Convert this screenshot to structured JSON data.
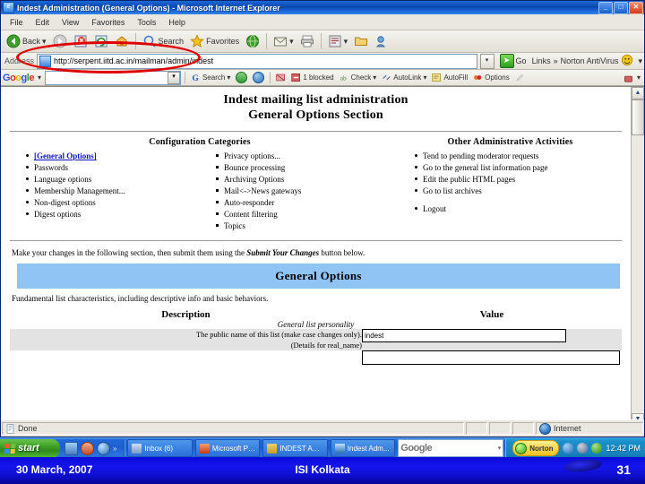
{
  "window": {
    "title": "Indest Administration (General Options) - Microsoft Internet Explorer",
    "icon": "ie-document-icon",
    "minimize_label": "_",
    "maximize_label": "□",
    "close_label": "✕"
  },
  "menubar": {
    "items": [
      {
        "label": "File"
      },
      {
        "label": "Edit"
      },
      {
        "label": "View"
      },
      {
        "label": "Favorites"
      },
      {
        "label": "Tools"
      },
      {
        "label": "Help"
      }
    ]
  },
  "toolbar": {
    "back_label": "Back",
    "back_icon": "back-arrow-icon",
    "back_dropdown": "▾",
    "forward_icon": "forward-arrow-icon",
    "stop_icon": "stop-icon",
    "refresh_icon": "refresh-icon",
    "home_icon": "home-icon",
    "search_label": "Search",
    "search_icon": "search-icon",
    "favorites_label": "Favorites",
    "favorites_icon": "star-icon",
    "media_icon": "media-globe-icon",
    "mail_icon": "mail-icon",
    "mail_dropdown": "▾",
    "print_icon": "printer-icon",
    "edit_icon": "edit-page-icon",
    "edit_dropdown": "▾",
    "discuss_icon": "folder-icon",
    "messenger_icon": "messenger-icon"
  },
  "address": {
    "label": "Address",
    "url": "http://serpent.iitd.ac.in/mailman/admin/indest",
    "favicon": "page-favicon",
    "dropdown": "▾",
    "go_label": "Go",
    "go_icon": "go-arrow-icon",
    "links_label": "Links",
    "links_chevron": "»",
    "norton_label": "Norton AntiVirus",
    "norton_icon": "norton-shield-icon",
    "norton_dropdown": "▾"
  },
  "google_toolbar": {
    "logo": [
      "G",
      "o",
      "o",
      "g",
      "l",
      "e"
    ],
    "logo_dropdown": "▾",
    "search_value": "",
    "search_dropdown": "▾",
    "items": [
      {
        "label": "Search",
        "icon": "google-g-icon",
        "dropdown": "▾"
      },
      {
        "label": "",
        "icon": "pagerank-icon"
      },
      {
        "label": "",
        "icon": "globe-icon"
      },
      {
        "label": "",
        "icon": "popup-blocker-icon"
      },
      {
        "label": "1 blocked",
        "icon": "blocked-icon"
      },
      {
        "label": "Check",
        "icon": "spellcheck-icon",
        "dropdown": "▾"
      },
      {
        "label": "AutoLink",
        "icon": "autolink-icon",
        "dropdown": "▾"
      },
      {
        "label": "AutoFill",
        "icon": "autofill-icon"
      },
      {
        "label": "Options",
        "icon": "options-icon"
      },
      {
        "label": "",
        "icon": "highlight-icon"
      }
    ],
    "right_icon": "google-menu-icon",
    "right_dropdown": "▾"
  },
  "page": {
    "heading_line1": "Indest mailing list administration",
    "heading_line2": "General Options Section",
    "config_title": "Configuration Categories",
    "config_left": [
      {
        "label": "[General Options]",
        "current": true,
        "link": true
      },
      {
        "label": "Passwords",
        "current": false,
        "link": false
      },
      {
        "label": "Language options",
        "current": false,
        "link": true
      },
      {
        "label": "Membership Management...",
        "current": false,
        "link": false
      },
      {
        "label": "Non-digest options",
        "current": false,
        "link": true
      },
      {
        "label": "Digest options",
        "current": false,
        "link": true
      }
    ],
    "config_right": [
      {
        "label": "Privacy options...",
        "link": true
      },
      {
        "label": "Bounce processing",
        "link": false
      },
      {
        "label": "Archiving Options",
        "link": true
      },
      {
        "label": "Mail<->News gateways",
        "link": false
      },
      {
        "label": "Auto-responder",
        "link": true
      },
      {
        "label": "Content filtering",
        "link": true
      },
      {
        "label": "Topics",
        "link": false
      }
    ],
    "admin_title": "Other Administrative Activities",
    "admin_items": [
      {
        "label": "Tend to pending moderator requests",
        "link": true
      },
      {
        "label": "Go to the general list information page",
        "link": false
      },
      {
        "label": "Edit the public HTML pages",
        "link": true
      },
      {
        "label": "Go to list archives",
        "link": false
      }
    ],
    "logout_label": "Logout",
    "instructions_pre": "Make your changes in the following section, then submit them using the ",
    "instructions_em": "Submit Your Changes",
    "instructions_post": " button below.",
    "section_banner": "General Options",
    "section_desc": "Fundamental list characteristics, including descriptive info and basic behaviors.",
    "col_description": "Description",
    "col_value": "Value",
    "group_label": "General list personality",
    "row1_desc": "The public name of this list (make case changes only).",
    "row1_details": "(Details for real_name)",
    "row1_value": "indest"
  },
  "statusbar": {
    "done_label": "Done",
    "done_icon": "page-icon",
    "zone_label": "Internet",
    "zone_icon": "internet-globe-icon"
  },
  "taskbar": {
    "start_label": "start",
    "start_icon": "windows-flag-icon",
    "quicklaunch": [
      {
        "icon": "show-desktop-icon"
      },
      {
        "icon": "outlook-icon"
      },
      {
        "icon": "ie-quicklaunch-icon"
      }
    ],
    "quicklaunch_chevron": "»",
    "tasks": [
      {
        "label": "Inbox (6)",
        "icon": "outlook-task-icon"
      },
      {
        "label": "Microsoft Po...",
        "icon": "powerpoint-task-icon"
      },
      {
        "label": "INDEST  Adm...",
        "icon": "folder-task-icon"
      },
      {
        "label": "Indest Adm...",
        "icon": "ie-task-icon"
      }
    ],
    "google_box": "Google",
    "google_dropdown": "▾",
    "norton_label": "Norton",
    "norton_icon": "norton-tray-icon",
    "tray_icons": [
      "volume-icon",
      "network-icon",
      "shield-icon"
    ],
    "clock": "12:42 PM"
  },
  "footer": {
    "date": "30 March, 2007",
    "center": "ISI Kolkata",
    "page_number": "31"
  },
  "colors": {
    "title_bar": "#0a48ad",
    "banner_blue": "#8fc4f5",
    "link_blue": "#1111cc",
    "annotation_red": "#e00000",
    "footer_blue": "#1515ef"
  }
}
